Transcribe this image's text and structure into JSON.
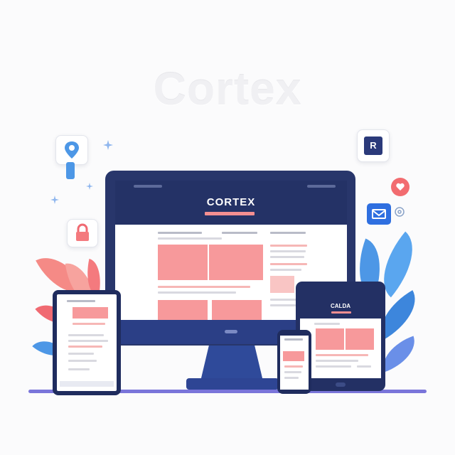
{
  "watermark": {
    "text": "Cortex"
  },
  "monitor": {
    "brand": "CORTEX"
  },
  "tablet_right": {
    "brand": "CALDA"
  },
  "icons": [
    "location-pin-icon",
    "sparkle-icon",
    "lock-icon",
    "brand-r-icon",
    "heart-icon",
    "mail-icon",
    "at-icon"
  ],
  "badge": {
    "letter": "R"
  },
  "colors": {
    "navy": "#28366b",
    "accent_pink": "#f48f91",
    "blue": "#2f4a9a",
    "leaf_blue": "#4d97e6",
    "leaf_coral": "#f47a7e"
  }
}
